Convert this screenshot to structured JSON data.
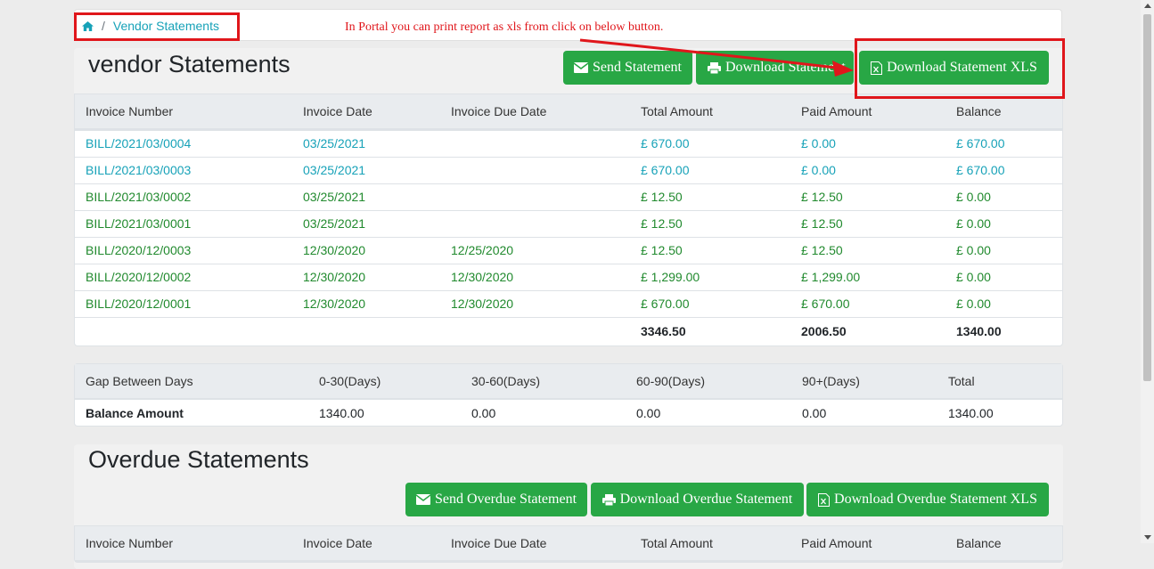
{
  "breadcrumb": {
    "current": "Vendor Statements",
    "separator": "/"
  },
  "annotation": {
    "text": "In Portal you can print report as xls from click on below button."
  },
  "colors": {
    "accent": "#28a745",
    "link": "#17a2b8",
    "annotation": "#e0161b"
  },
  "vendor": {
    "title": "vendor Statements",
    "buttons": {
      "send": "Send Statement",
      "download": "Download Statement",
      "download_xls": "Download Statement XLS"
    },
    "columns": [
      "Invoice Number",
      "Invoice Date",
      "Invoice Due Date",
      "Total Amount",
      "Paid Amount",
      "Balance"
    ],
    "rows": [
      [
        "BILL/2021/03/0004",
        "03/25/2021",
        "",
        "£ 670.00",
        "£ 0.00",
        "£ 670.00"
      ],
      [
        "BILL/2021/03/0003",
        "03/25/2021",
        "",
        "£ 670.00",
        "£ 0.00",
        "£ 670.00"
      ],
      [
        "BILL/2021/03/0002",
        "03/25/2021",
        "",
        "£ 12.50",
        "£ 12.50",
        "£ 0.00"
      ],
      [
        "BILL/2021/03/0001",
        "03/25/2021",
        "",
        "£ 12.50",
        "£ 12.50",
        "£ 0.00"
      ],
      [
        "BILL/2020/12/0003",
        "12/30/2020",
        "12/25/2020",
        "£ 12.50",
        "£ 12.50",
        "£ 0.00"
      ],
      [
        "BILL/2020/12/0002",
        "12/30/2020",
        "12/30/2020",
        "£ 1,299.00",
        "£ 1,299.00",
        "£ 0.00"
      ],
      [
        "BILL/2020/12/0001",
        "12/30/2020",
        "12/30/2020",
        "£ 670.00",
        "£ 670.00",
        "£ 0.00"
      ]
    ],
    "totals": {
      "total": "3346.50",
      "paid": "2006.50",
      "balance": "1340.00"
    }
  },
  "aging": {
    "columns": [
      "Gap Between Days",
      "0-30(Days)",
      "30-60(Days)",
      "60-90(Days)",
      "90+(Days)",
      "Total"
    ],
    "row": [
      "Balance Amount",
      "1340.00",
      "0.00",
      "0.00",
      "0.00",
      "1340.00"
    ]
  },
  "overdue": {
    "title": "Overdue Statements",
    "buttons": {
      "send": "Send Overdue Statement",
      "download": "Download Overdue Statement",
      "download_xls": "Download Overdue Statement XLS"
    },
    "columns": [
      "Invoice Number",
      "Invoice Date",
      "Invoice Due Date",
      "Total Amount",
      "Paid Amount",
      "Balance"
    ]
  }
}
